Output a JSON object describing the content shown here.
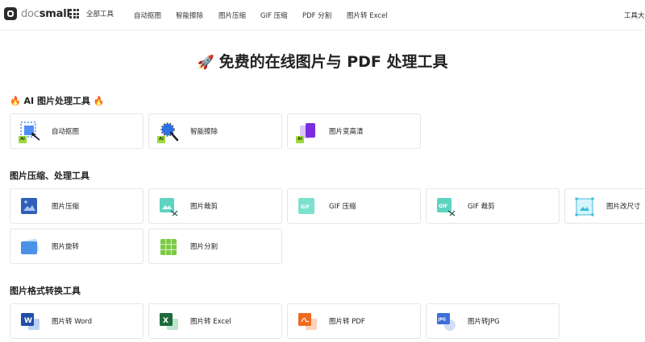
{
  "header": {
    "logo_doc": "doc",
    "logo_small": "small",
    "all_tools": "全部工具",
    "nav": [
      "自动抠图",
      "智能擦除",
      "图片压缩",
      "GIF 压缩",
      "PDF 分割",
      "图片转 Excel"
    ],
    "toolbox": "工具大"
  },
  "hero": {
    "icon": "rocket-icon",
    "title": "免费的在线图片与 PDF 处理工具"
  },
  "sections": [
    {
      "title": "AI 图片处理工具",
      "decor_icon": "fire-icon",
      "items": [
        {
          "label": "自动抠图",
          "icon": "auto-cutout-icon"
        },
        {
          "label": "智能擦除",
          "icon": "smart-erase-icon"
        },
        {
          "label": "图片变高清",
          "icon": "enhance-icon"
        }
      ]
    },
    {
      "title": "图片压缩、处理工具",
      "items": [
        {
          "label": "图片压缩",
          "icon": "image-compress-icon"
        },
        {
          "label": "图片裁剪",
          "icon": "image-crop-icon"
        },
        {
          "label": "GIF 压缩",
          "icon": "gif-compress-icon"
        },
        {
          "label": "GIF 裁剪",
          "icon": "gif-crop-icon"
        },
        {
          "label": "图片改尺寸",
          "icon": "image-resize-icon"
        },
        {
          "label": "图片旋转",
          "icon": "image-rotate-icon"
        },
        {
          "label": "图片分割",
          "icon": "image-split-icon"
        }
      ]
    },
    {
      "title": "图片格式转换工具",
      "items": [
        {
          "label": "图片转 Word",
          "icon": "image-to-word-icon"
        },
        {
          "label": "图片转 Excel",
          "icon": "image-to-excel-icon"
        },
        {
          "label": "图片转 PDF",
          "icon": "image-to-pdf-icon"
        },
        {
          "label": "图片转JPG",
          "icon": "image-to-jpg-icon"
        }
      ]
    }
  ],
  "badges": {
    "ai": "AI",
    "gif": "GIF",
    "word": "W",
    "excel": "X",
    "jpg": "JPG"
  },
  "colors": {
    "accent_blue": "#2f6fe4",
    "ai_green": "#9ed93e",
    "fire": "#f06a1d"
  }
}
